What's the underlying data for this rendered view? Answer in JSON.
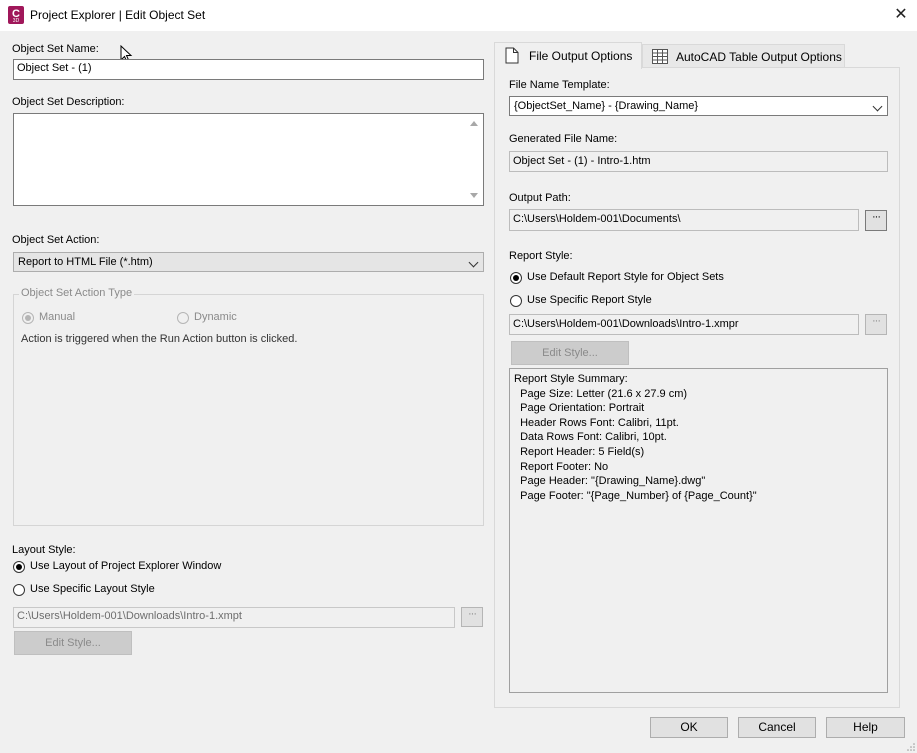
{
  "window": {
    "title": "Project Explorer | Edit Object Set",
    "app_icon_letter": "C",
    "app_icon_sub": "3D",
    "close_glyph": "✕"
  },
  "left": {
    "name_label": "Object Set Name:",
    "name_value": "Object Set - (1)",
    "description_label": "Object Set Description:",
    "description_value": "",
    "action_label": "Object Set Action:",
    "action_value": "Report to HTML File (*.htm)",
    "action_type": {
      "title": "Object Set Action Type",
      "manual": "Manual",
      "dynamic": "Dynamic",
      "selected": "manual",
      "hint": "Action is triggered when the Run Action button is clicked."
    },
    "layout": {
      "label": "Layout Style:",
      "option_window": "Use Layout of Project Explorer Window",
      "option_specific": "Use Specific Layout Style",
      "selected": "window",
      "path": "C:\\Users\\Holdem-001\\Downloads\\Intro-1.xmpt",
      "edit_label": "Edit Style..."
    }
  },
  "tabs": [
    {
      "label": "File Output Options",
      "icon": "document-icon",
      "active": true
    },
    {
      "label": "AutoCAD Table Output Options",
      "icon": "table-icon",
      "active": false
    }
  ],
  "right": {
    "template_label": "File Name Template:",
    "template_value": "{ObjectSet_Name} - {Drawing_Name}",
    "generated_label": "Generated File Name:",
    "generated_value": "Object Set - (1) - Intro-1.htm",
    "output_label": "Output Path:",
    "output_value": "C:\\Users\\Holdem-001\\Documents\\",
    "report_style_label": "Report Style:",
    "option_default": "Use Default Report Style for Object Sets",
    "option_specific": "Use Specific Report Style",
    "selected": "default",
    "style_path": "C:\\Users\\Holdem-001\\Downloads\\Intro-1.xmpr",
    "edit_label": "Edit Style...",
    "summary_lines": [
      "Report Style Summary:",
      "  Page Size: Letter (21.6 x 27.9 cm)",
      "  Page Orientation: Portrait",
      "  Header Rows Font: Calibri, 11pt.",
      "  Data Rows Font: Calibri, 10pt.",
      "  Report Header: 5 Field(s)",
      "  Report Footer: No",
      "  Page Header: \"{Drawing_Name}.dwg\"",
      "  Page Footer: \"{Page_Number} of {Page_Count}\""
    ]
  },
  "footer": {
    "ok": "OK",
    "cancel": "Cancel",
    "help": "Help"
  },
  "browse_glyph": "···"
}
